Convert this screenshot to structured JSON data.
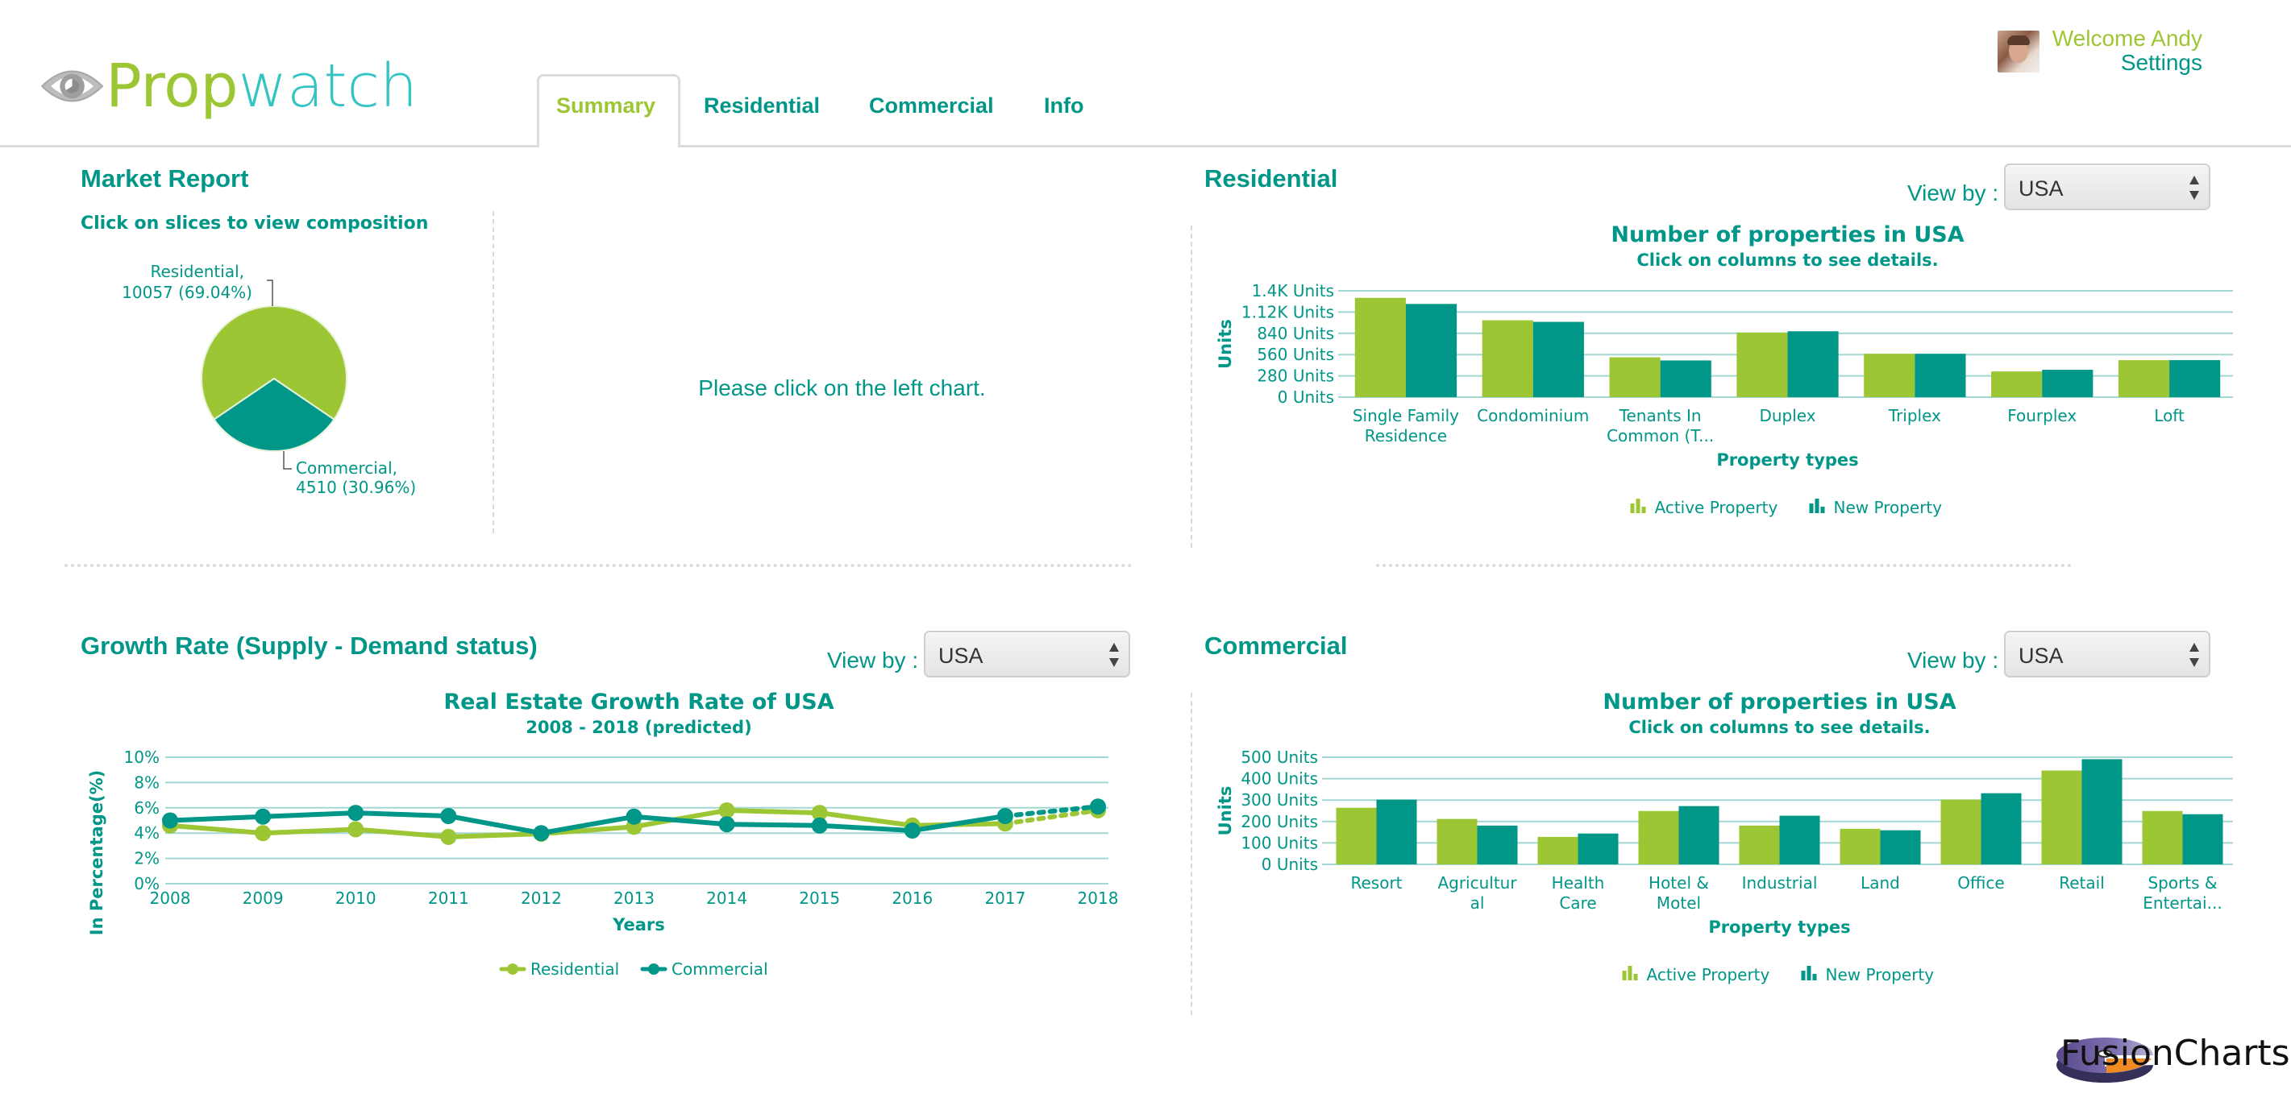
{
  "header": {
    "logo": {
      "part1": "Prop",
      "part2": "watch"
    },
    "tabs": [
      {
        "label": "Summary",
        "active": true
      },
      {
        "label": "Residential",
        "active": false
      },
      {
        "label": "Commercial",
        "active": false
      },
      {
        "label": "Info",
        "active": false
      }
    ],
    "user": {
      "welcome": "Welcome Andy",
      "settings": "Settings"
    }
  },
  "market_report": {
    "title": "Market Report",
    "subtitle": "Click on slices to view composition",
    "placeholder_message": "Please click on the left chart."
  },
  "residential_panel": {
    "title": "Residential",
    "view_by_label": "View by :",
    "view_by_value": "USA"
  },
  "growth_panel": {
    "title": "Growth Rate (Supply - Demand status)",
    "view_by_label": "View by :",
    "view_by_value": "USA"
  },
  "commercial_panel": {
    "title": "Commercial",
    "view_by_label": "View by :",
    "view_by_value": "USA"
  },
  "footer": {
    "brand": "FusionCharts"
  },
  "colors": {
    "green": "#9dc634",
    "teal": "#009688",
    "grid": "#a3d8d2"
  },
  "chart_data": [
    {
      "id": "market-pie",
      "type": "pie",
      "title": "Click on slices to view composition",
      "slices": [
        {
          "label": "Residential",
          "value": 10057,
          "percent": "69.04%",
          "display": "Residential,",
          "display2": "10057 (69.04%)",
          "color": "#9dc634"
        },
        {
          "label": "Commercial",
          "value": 4510,
          "percent": "30.96%",
          "display": "Commercial,",
          "display2": "4510 (30.96%)",
          "color": "#009688"
        }
      ]
    },
    {
      "id": "residential-bar",
      "type": "bar",
      "title": "Number of properties in USA",
      "subtitle": "Click on columns to see details.",
      "xlabel": "Property types",
      "ylabel": "Units",
      "ylim": [
        0,
        1400
      ],
      "yticks": [
        {
          "value": 0,
          "label": "0 Units"
        },
        {
          "value": 280,
          "label": "280 Units"
        },
        {
          "value": 560,
          "label": "560 Units"
        },
        {
          "value": 840,
          "label": "840 Units"
        },
        {
          "value": 1120,
          "label": "1.12K Units"
        },
        {
          "value": 1400,
          "label": "1.4K Units"
        }
      ],
      "categories": [
        [
          "Single Family",
          "Residence"
        ],
        [
          "Condominium"
        ],
        [
          "Tenants In",
          "Common (T..."
        ],
        [
          "Duplex"
        ],
        [
          "Triplex"
        ],
        [
          "Fourplex"
        ],
        [
          "Loft"
        ]
      ],
      "series": [
        {
          "name": "Active Property",
          "color": "#9dc634",
          "values": [
            1308,
            1012,
            525,
            850,
            571,
            338,
            487
          ]
        },
        {
          "name": "New Property",
          "color": "#009688",
          "values": [
            1227,
            991,
            483,
            867,
            571,
            360,
            487
          ]
        }
      ],
      "legend": "bottom-center"
    },
    {
      "id": "growth-line",
      "type": "line",
      "title": "Real Estate Growth Rate of USA",
      "subtitle": "2008 - 2018 (predicted)",
      "xlabel": "Years",
      "ylabel": "In Percentage(%)",
      "ylim": [
        0,
        10
      ],
      "yticks": [
        {
          "value": 0,
          "label": "0%"
        },
        {
          "value": 2,
          "label": "2%"
        },
        {
          "value": 4,
          "label": "4%"
        },
        {
          "value": 6,
          "label": "6%"
        },
        {
          "value": 8,
          "label": "8%"
        },
        {
          "value": 10,
          "label": "10%"
        }
      ],
      "x": [
        "2008",
        "2009",
        "2010",
        "2011",
        "2012",
        "2013",
        "2014",
        "2015",
        "2016",
        "2017",
        "2018"
      ],
      "predicted_from_index": 9,
      "series": [
        {
          "name": "Residential",
          "color": "#9dc634",
          "values": [
            4.6,
            4.0,
            4.3,
            3.7,
            3.95,
            4.5,
            5.8,
            5.6,
            4.6,
            4.75,
            5.8
          ]
        },
        {
          "name": "Commercial",
          "color": "#009688",
          "values": [
            5.0,
            5.3,
            5.6,
            5.35,
            4.0,
            5.3,
            4.7,
            4.6,
            4.2,
            5.35,
            6.1
          ]
        }
      ],
      "legend": "bottom-center"
    },
    {
      "id": "commercial-bar",
      "type": "bar",
      "title": "Number of properties in USA",
      "subtitle": "Click on columns to see details.",
      "xlabel": "Property types",
      "ylabel": "Units",
      "ylim": [
        0,
        500
      ],
      "yticks": [
        {
          "value": 0,
          "label": "0 Units"
        },
        {
          "value": 100,
          "label": "100 Units"
        },
        {
          "value": 200,
          "label": "200 Units"
        },
        {
          "value": 300,
          "label": "300 Units"
        },
        {
          "value": 400,
          "label": "400 Units"
        },
        {
          "value": 500,
          "label": "500 Units"
        }
      ],
      "categories": [
        [
          "Resort"
        ],
        [
          "Agricultur",
          "al"
        ],
        [
          "Health",
          "Care"
        ],
        [
          "Hotel &",
          "Motel"
        ],
        [
          "Industrial"
        ],
        [
          "Land"
        ],
        [
          "Office"
        ],
        [
          "Retail"
        ],
        [
          "Sports &",
          "Entertai..."
        ]
      ],
      "series": [
        {
          "name": "Active Property",
          "color": "#9dc634",
          "values": [
            264,
            212,
            128,
            249,
            181,
            166,
            302,
            438,
            249
          ]
        },
        {
          "name": "New Property",
          "color": "#009688",
          "values": [
            302,
            181,
            144,
            272,
            227,
            159,
            332,
            491,
            234
          ]
        }
      ],
      "legend": "bottom-center"
    }
  ]
}
